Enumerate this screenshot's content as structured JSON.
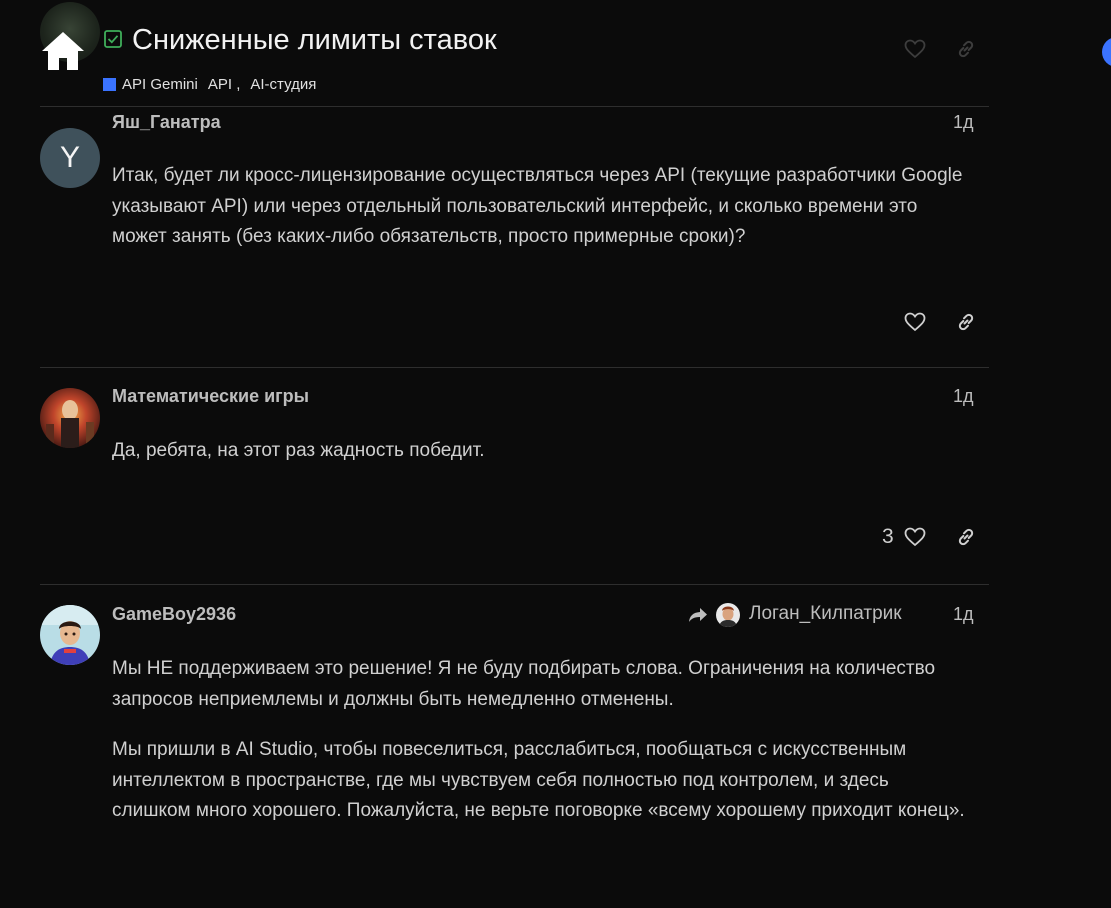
{
  "header": {
    "title": "Сниженные лимиты ставок",
    "category": "API Gemini",
    "tags": [
      "API ,",
      "AI-студия"
    ]
  },
  "posts": [
    {
      "username": "Яш_Ганатра",
      "avatar_letter": "Y",
      "date": "1д",
      "paragraphs": [
        "Итак, будет ли кросс-лицензирование осуществляться через API (текущие разработчики Google указывают API) или через отдельный пользовательский интерфейс, и сколько времени это может занять (без каких-либо обязательств, просто примерные сроки)?"
      ]
    },
    {
      "username": "Математические игры",
      "date": "1д",
      "paragraphs": [
        "Да, ребята, на этот раз жадность победит."
      ],
      "likes": "3"
    },
    {
      "username": "GameBoy2936",
      "date": "1д",
      "reply_to": "Логан_Килпатрик",
      "paragraphs": [
        "Мы НЕ поддерживаем это решение! Я не буду подбирать слова. Ограничения на количество запросов неприемлемы и должны быть немедленно отменены.",
        "Мы пришли в AI Studio, чтобы повеселиться, расслабиться, пообщаться с искусственным интеллектом в пространстве, где мы чувствуем себя полностью под контролем, и здесь слишком много хорошего. Пожалуйста, не верьте поговорке «всему хорошему приходит конец»."
      ]
    }
  ],
  "colors": {
    "background": "#0b0b0b",
    "category": "#3a73ff",
    "solved_check": "#3fae5a",
    "avatar_y": "#3f515b"
  }
}
